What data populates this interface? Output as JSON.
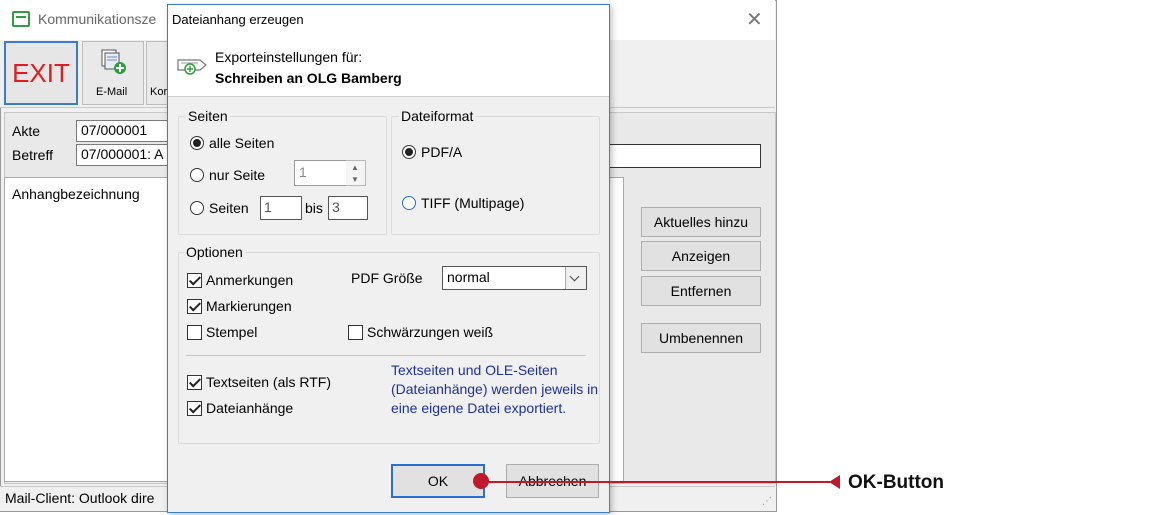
{
  "main_window": {
    "title": "Kommunikationsze",
    "toolbar": {
      "exit_label": "EXIT",
      "email_label": "E-Mail",
      "ko_label": "Kor"
    },
    "akte_label": "Akte",
    "akte_value": "07/000001",
    "betreff_label": "Betreff",
    "betreff_value": "07/000001: A",
    "list_header": "Anhangbezeichnung",
    "side_buttons": [
      "Aktuelles hinzu",
      "Anzeigen",
      "Entfernen",
      "Umbenennen"
    ],
    "status": "Mail-Client: Outlook dire"
  },
  "dialog": {
    "title": "Dateianhang erzeugen",
    "export_label": "Exporteinstellungen für:",
    "export_target": "Schreiben an OLG Bamberg",
    "seiten": {
      "group_title": "Seiten",
      "opt_all": "alle Seiten",
      "opt_only": "nur Seite",
      "only_value": "1",
      "opt_range": "Seiten",
      "range_from": "1",
      "range_bis": "bis",
      "range_to": "3",
      "selected": "alle Seiten"
    },
    "dateiformat": {
      "group_title": "Dateiformat",
      "opt_pdfa": "PDF/A",
      "opt_tiff": "TIFF (Multipage)",
      "selected": "PDF/A"
    },
    "optionen": {
      "group_title": "Optionen",
      "anmerkungen": {
        "label": "Anmerkungen",
        "checked": true
      },
      "markierungen": {
        "label": "Markierungen",
        "checked": true
      },
      "stempel": {
        "label": "Stempel",
        "checked": false
      },
      "schwaerzungen": {
        "label": "Schwärzungen weiß",
        "checked": false
      },
      "pdf_size_label": "PDF Größe",
      "pdf_size_value": "normal",
      "textseiten": {
        "label": "Textseiten (als RTF)",
        "checked": true
      },
      "dateianhaenge": {
        "label": "Dateianhänge",
        "checked": true
      },
      "info": "Textseiten und OLE-Seiten (Dateianhänge) werden jeweils in eine eigene Datei exportiert."
    },
    "ok_label": "OK",
    "cancel_label": "Abbrechen"
  },
  "annotation": {
    "label": "OK-Button",
    "color": "#c0182c"
  }
}
